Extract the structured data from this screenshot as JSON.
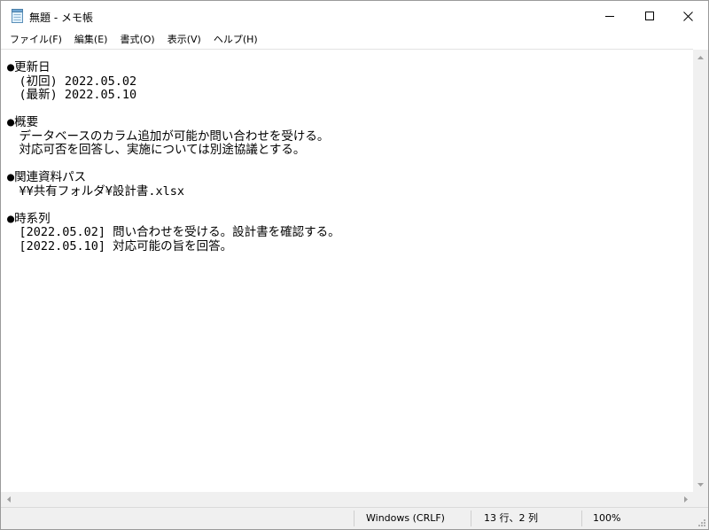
{
  "window": {
    "title": "無題 - メモ帳"
  },
  "menu": {
    "items": [
      "ファイル(F)",
      "編集(E)",
      "書式(O)",
      "表示(V)",
      "ヘルプ(H)"
    ]
  },
  "editor": {
    "lines": [
      "●更新日",
      "　(初回) 2022.05.02",
      "　(最新) 2022.05.10",
      "",
      "●概要",
      "　データベースのカラム追加が可能か問い合わせを受ける。",
      "　対応可否を回答し、実施については別途協議とする。",
      "",
      "●関連資料パス",
      "　¥¥共有フォルダ¥設計書.xlsx",
      "",
      "●時系列",
      "　[2022.05.02] 問い合わせを受ける。設計書を確認する。",
      "　[2022.05.10] 対応可能の旨を回答。"
    ]
  },
  "statusbar": {
    "encoding": "Windows (CRLF)",
    "position": "13 行、2 列",
    "zoom": "100%"
  },
  "icons": {
    "app": "notepad-icon",
    "minimize": "minimize-icon",
    "maximize": "maximize-icon",
    "close": "close-icon"
  }
}
